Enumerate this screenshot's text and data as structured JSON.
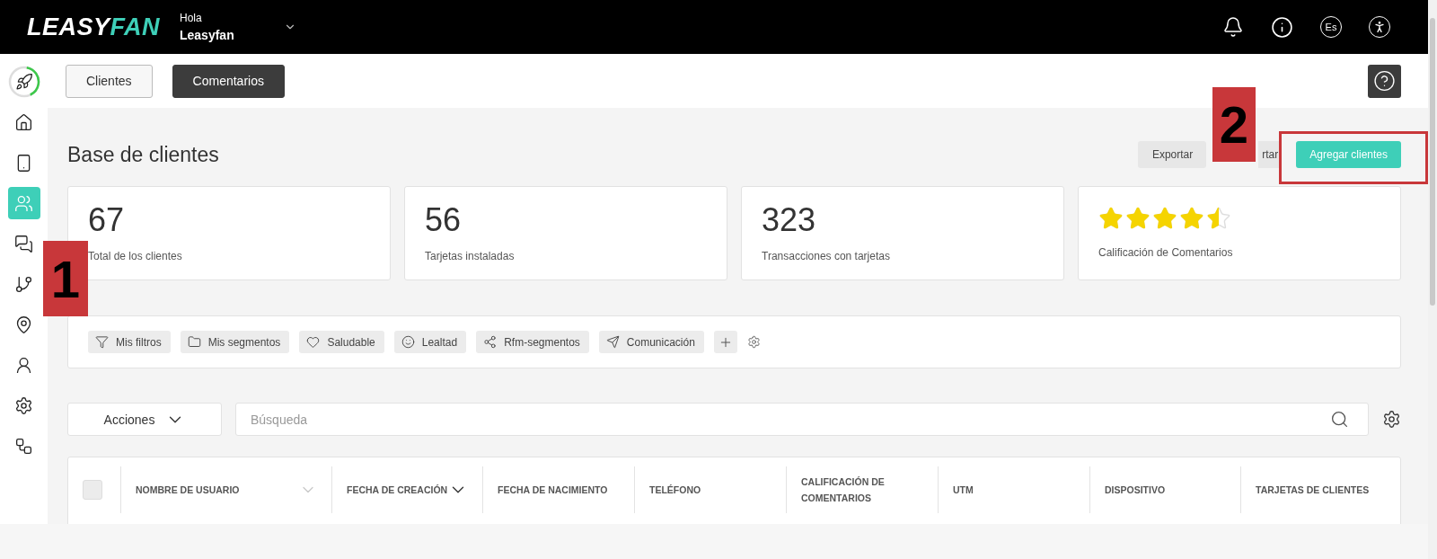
{
  "header": {
    "logo": {
      "part_1": "LEASY",
      "part_2": "FAN"
    },
    "greeting": "Hola",
    "account": "Leasyfan",
    "language": "Es"
  },
  "sidebar": {
    "progress": {
      "level": 0.4
    },
    "items": [
      {
        "selected": false
      },
      {
        "selected": false
      },
      {
        "selected": true
      },
      {
        "selected": false
      },
      {
        "selected": false
      },
      {
        "selected": false
      },
      {
        "selected": false
      },
      {
        "selected": false
      },
      {
        "selected": false
      }
    ]
  },
  "tabs": [
    {
      "label": "Clientes",
      "selected": false
    },
    {
      "label": "Comentarios",
      "selected": true
    }
  ],
  "title": "Base de clientes",
  "actions": [
    {
      "label": "Exportar",
      "kind": "secondary"
    },
    {
      "label": "rtar",
      "kind": "covered"
    },
    {
      "label": "Agregar clientes",
      "kind": "primary"
    }
  ],
  "stats": [
    {
      "kind": "number",
      "value": "67",
      "label": "Total de los clientes"
    },
    {
      "kind": "number",
      "value": "56",
      "label": "Tarjetas instaladas"
    },
    {
      "kind": "number",
      "value": "323",
      "label": "Transacciones con tarjetas"
    },
    {
      "kind": "rating",
      "stars": 4.5,
      "label": "Calificación de Comentarios"
    }
  ],
  "filters": [
    {
      "label": "Mis filtros"
    },
    {
      "label": "Mis segmentos"
    },
    {
      "label": "Saludable"
    },
    {
      "label": "Lealtad"
    },
    {
      "label": "Rfm-segmentos"
    },
    {
      "label": "Comunicación"
    }
  ],
  "toolbar": {
    "actions_menu": "Acciones",
    "search": {
      "placeholder": "Búsqueda"
    }
  },
  "table": {
    "select_all": {
      "checked": false
    },
    "columns": [
      {
        "label": "NOMBRE DE USUARIO",
        "sort_icon": true,
        "sort_active": false
      },
      {
        "label": "FECHA DE CREACIÓN",
        "sort_icon": true,
        "sort_active": true
      },
      {
        "label": "FECHA DE NACIMIENTO",
        "sort_icon": false
      },
      {
        "label": "TELÉFONO",
        "sort_icon": false
      },
      {
        "label": "CALIFICACIÓN DE COMENTARIOS",
        "sort_icon": false
      },
      {
        "label": "UTM",
        "sort_icon": false
      },
      {
        "label": "DISPOSITIVO",
        "sort_icon": false
      },
      {
        "label": "TARJETAS DE CLIENTES",
        "sort_icon": false
      }
    ]
  },
  "annotations": [
    {
      "label": "1"
    },
    {
      "label": "2"
    }
  ]
}
